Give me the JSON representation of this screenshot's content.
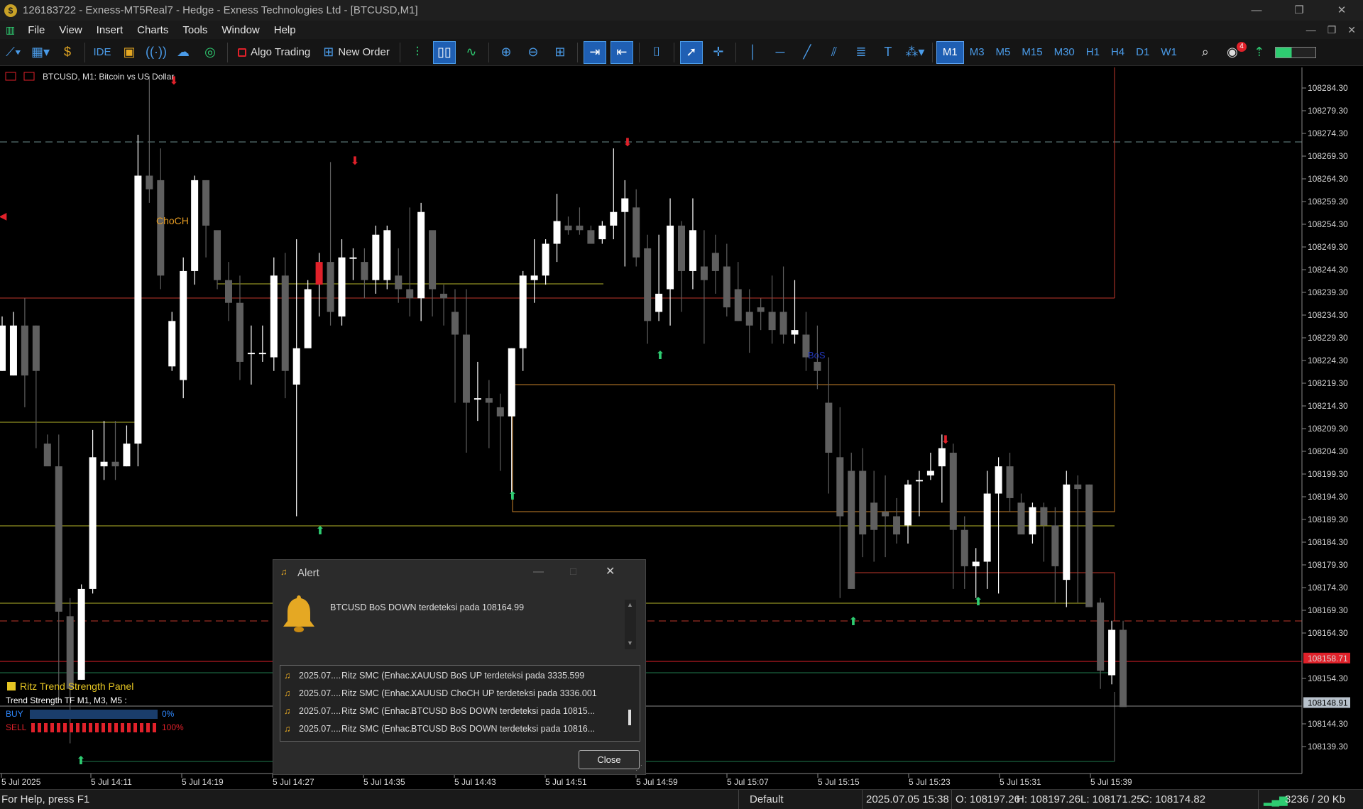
{
  "window": {
    "title": "126183722 - Exness-MT5Real7 - Hedge - Exness Technologies Ltd - [BTCUSD,M1]",
    "controls": [
      "—",
      "❐",
      "✕"
    ]
  },
  "menu": {
    "items": [
      "File",
      "View",
      "Insert",
      "Charts",
      "Tools",
      "Window",
      "Help"
    ],
    "right_controls": [
      "—",
      "❐",
      "✕"
    ]
  },
  "toolbar": {
    "algo_trading": "Algo Trading",
    "new_order": "New Order",
    "ide": "IDE",
    "notification_count": "4",
    "timeframes": [
      "M1",
      "M3",
      "M5",
      "M15",
      "M30",
      "H1",
      "H4",
      "D1",
      "W1"
    ],
    "active_timeframe": "M1"
  },
  "chart": {
    "header": "BTCUSD, M1:  Bitcoin vs US Dollar",
    "price_labels": [
      "108284.30",
      "108279.30",
      "108274.30",
      "108269.30",
      "108264.30",
      "108259.30",
      "108254.30",
      "108249.30",
      "108244.30",
      "108239.30",
      "108234.30",
      "108229.30",
      "108224.30",
      "108219.30",
      "108214.30",
      "108209.30",
      "108204.30",
      "108199.30",
      "108194.30",
      "108189.30",
      "108184.30",
      "108179.30",
      "108174.30",
      "108169.30",
      "108164.30",
      "108158.71",
      "108154.30",
      "108148.91",
      "108144.30",
      "108139.30"
    ],
    "ask_price": "108158.71",
    "bid_price": "108148.91",
    "time_labels": [
      "5 Jul 2025",
      "5 Jul 14:11",
      "5 Jul 14:19",
      "5 Jul 14:27",
      "5 Jul 14:35",
      "5 Jul 14:43",
      "5 Jul 14:51",
      "5 Jul 14:59",
      "5 Jul 15:07",
      "5 Jul 15:15",
      "5 Jul 15:23",
      "5 Jul 15:31",
      "5 Jul 15:39"
    ],
    "annotations": {
      "choch": "ChoCH",
      "bos": "BoS"
    },
    "panel": {
      "title": "Ritz Trend Strength Panel",
      "subtitle": "Trend Strength TF M1, M3, M5 :",
      "buy_label": "BUY",
      "buy_pct": "0%",
      "sell_label": "SELL",
      "sell_pct": "100%",
      "buy_value": 0,
      "sell_value": 1.0
    }
  },
  "alert": {
    "title": "Alert",
    "message": "BTCUSD BoS DOWN terdeteksi pada 108164.99",
    "rows": [
      {
        "time": "2025.07....",
        "source": "Ritz SMC (Enhac...",
        "message": "XAUUSD BoS UP terdeteksi pada 3335.599"
      },
      {
        "time": "2025.07....",
        "source": "Ritz SMC (Enhac...",
        "message": "XAUUSD ChoCH UP terdeteksi pada 3336.001"
      },
      {
        "time": "2025.07....",
        "source": "Ritz SMC (Enhac...",
        "message": "BTCUSD BoS DOWN terdeteksi pada 10815..."
      },
      {
        "time": "2025.07....",
        "source": "Ritz SMC (Enhac...",
        "message": "BTCUSD BoS DOWN terdeteksi pada 10816..."
      }
    ],
    "close_label": "Close"
  },
  "status": {
    "help": "For Help, press F1",
    "profile": "Default",
    "datetime": "2025.07.05 15:38",
    "open": "O: 108197.26",
    "high": "H: 108197.26",
    "low": "L: 108171.25",
    "close": "C: 108174.82",
    "traffic": "3236 / 20 Kb"
  },
  "colors": {
    "bull": "#ffffff",
    "bear": "#5f5f5f",
    "ask_line": "#e0212a",
    "bid_line": "#8a8a8a",
    "accent": "#1f5fb3",
    "level_yellow": "#b5b52a",
    "level_red": "#c0392b",
    "zone_orange": "#c8822a"
  },
  "candles": [
    [
      0,
      108222,
      108232,
      108234,
      108222
    ],
    [
      1,
      108221,
      108232,
      108235,
      108221
    ],
    [
      2,
      108232,
      108221,
      108238,
      108214
    ],
    [
      3,
      108232,
      108222,
      108232,
      108205
    ],
    [
      4,
      108206,
      108201,
      108208,
      108203
    ],
    [
      5,
      108201,
      108169,
      108208,
      108150
    ],
    [
      6,
      108168,
      108152,
      108172,
      108140
    ],
    [
      7,
      108154,
      108174,
      108175,
      108154
    ],
    [
      8,
      108174,
      108203,
      108209,
      108173
    ],
    [
      9,
      108201,
      108202,
      108211,
      108198
    ],
    [
      10,
      108202,
      108201,
      108211,
      108198
    ],
    [
      11,
      108201,
      108206,
      108210,
      108201
    ],
    [
      12,
      108206,
      108265,
      108274,
      108201
    ],
    [
      13,
      108265,
      108262,
      108287,
      108259
    ],
    [
      14,
      108264,
      108243,
      108271,
      108240
    ],
    [
      15,
      108223,
      108233,
      108235,
      108222
    ],
    [
      16,
      108220,
      108244,
      108247,
      108216
    ],
    [
      17,
      108244,
      108264,
      108265,
      108241
    ],
    [
      18,
      108264,
      108254,
      108264,
      108247
    ],
    [
      19,
      108253,
      108242,
      108248,
      108240
    ],
    [
      20,
      108242,
      108237,
      108246,
      108233
    ],
    [
      21,
      108237,
      108224,
      108243,
      108220
    ],
    [
      22,
      108226,
      108226,
      108232,
      108219
    ],
    [
      23,
      108226,
      108226,
      108232,
      108224
    ],
    [
      24,
      108225,
      108243,
      108247,
      108222
    ],
    [
      25,
      108243,
      108222,
      108248,
      108216
    ],
    [
      26,
      108219,
      108227,
      108251,
      108190
    ],
    [
      27,
      108227,
      108240,
      108242,
      108231
    ],
    [
      28,
      108241,
      108246,
      108248,
      108234
    ],
    [
      29,
      108246,
      108235,
      108268,
      108232
    ],
    [
      30,
      108234,
      108247,
      108251,
      108232
    ],
    [
      31,
      108247,
      108247,
      108249,
      108242
    ],
    [
      32,
      108246,
      108242,
      108249,
      108238
    ],
    [
      33,
      108242,
      108252,
      108254,
      108239
    ],
    [
      34,
      108242,
      108253,
      108254,
      108240
    ],
    [
      35,
      108243,
      108240,
      108249,
      108237
    ],
    [
      36,
      108240,
      108238,
      108258,
      108234
    ],
    [
      37,
      108238,
      108257,
      108259,
      108233
    ],
    [
      38,
      108253,
      108240,
      108249,
      108234
    ],
    [
      39,
      108239,
      108238,
      108241,
      108232
    ],
    [
      40,
      108235,
      108230,
      108240,
      108215
    ],
    [
      41,
      108230,
      108215,
      108240,
      108204
    ],
    [
      42,
      108216,
      108216,
      108224,
      108211
    ],
    [
      43,
      108216,
      108215,
      108220,
      108205
    ],
    [
      44,
      108214,
      108212,
      108217,
      108200
    ],
    [
      45,
      108212,
      108227,
      108227,
      108194
    ],
    [
      46,
      108227,
      108243,
      108244,
      108222
    ],
    [
      47,
      108242,
      108243,
      108251,
      108237
    ],
    [
      48,
      108243,
      108250,
      108251,
      108241
    ],
    [
      49,
      108250,
      108255,
      108261,
      108246
    ],
    [
      50,
      108254,
      108253,
      108256,
      108252
    ],
    [
      51,
      108254,
      108253,
      108258,
      108252
    ],
    [
      52,
      108253,
      108250,
      108254,
      108253
    ],
    [
      53,
      108251,
      108254,
      108255,
      108250
    ],
    [
      54,
      108254,
      108257,
      108271,
      108251
    ],
    [
      55,
      108257,
      108260,
      108264,
      108245
    ],
    [
      56,
      108258,
      108247,
      108262,
      108245
    ],
    [
      57,
      108249,
      108233,
      108252,
      108228
    ],
    [
      58,
      108235,
      108239,
      108252,
      108233
    ],
    [
      59,
      108240,
      108254,
      108260,
      108232
    ],
    [
      60,
      108254,
      108244,
      108255,
      108235
    ],
    [
      61,
      108244,
      108253,
      108260,
      108240
    ],
    [
      62,
      108245,
      108242,
      108253,
      108228
    ],
    [
      63,
      108248,
      108244,
      108252,
      108239
    ],
    [
      64,
      108245,
      108236,
      108250,
      108234
    ],
    [
      65,
      108240,
      108233,
      108246,
      108233
    ],
    [
      66,
      108235,
      108232,
      108240,
      108226
    ],
    [
      67,
      108236,
      108235,
      108238,
      108231
    ],
    [
      68,
      108235,
      108231,
      108243,
      108228
    ],
    [
      69,
      108235,
      108230,
      108245,
      108228
    ],
    [
      70,
      108230,
      108231,
      108242,
      108228
    ],
    [
      71,
      108230,
      108225,
      108235,
      108222
    ],
    [
      72,
      108224,
      108222,
      108232,
      108218
    ],
    [
      73,
      108215,
      108204,
      108225,
      108195
    ],
    [
      74,
      108203,
      108190,
      108214,
      108172
    ],
    [
      75,
      108200,
      108174,
      108204,
      108176
    ],
    [
      76,
      108200,
      108186,
      108205,
      108181
    ],
    [
      77,
      108193,
      108187,
      108200,
      108180
    ],
    [
      78,
      108191,
      108190,
      108199,
      108181
    ],
    [
      79,
      108190,
      108186,
      108194,
      108184
    ],
    [
      80,
      108188,
      108197,
      108198,
      108184
    ],
    [
      81,
      108198,
      108198,
      108200,
      108190
    ],
    [
      82,
      108199,
      108200,
      108204,
      108198
    ],
    [
      83,
      108201,
      108205,
      108208,
      108193
    ],
    [
      84,
      108204,
      108187,
      108206,
      108174
    ],
    [
      85,
      108187,
      108179,
      108190,
      108174
    ],
    [
      86,
      108179,
      108180,
      108183,
      108172
    ],
    [
      87,
      108180,
      108195,
      108200,
      108174
    ],
    [
      88,
      108195,
      108201,
      108203,
      108173
    ],
    [
      89,
      108201,
      108194,
      108204,
      108191
    ],
    [
      90,
      108193,
      108186,
      108195,
      108188
    ],
    [
      91,
      108186,
      108192,
      108193,
      108184
    ],
    [
      92,
      108192,
      108188,
      108193,
      108180
    ],
    [
      93,
      108188,
      108179,
      108192,
      108171
    ],
    [
      94,
      108176,
      108197,
      108200,
      108170
    ],
    [
      95,
      108197,
      108196,
      108199,
      108171
    ],
    [
      96,
      108197,
      108170,
      108197,
      108172
    ],
    [
      97,
      108171,
      108156,
      108172,
      108152
    ],
    [
      98,
      108155,
      108165,
      108167,
      108153
    ],
    [
      99,
      108165,
      108148,
      108167,
      108149
    ]
  ]
}
